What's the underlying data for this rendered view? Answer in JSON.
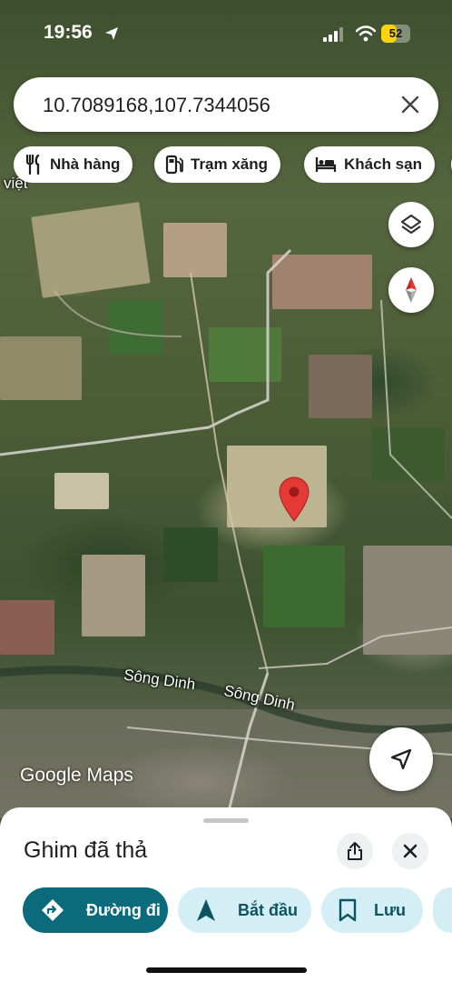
{
  "status_bar": {
    "time": "19:56",
    "battery": "52",
    "battery_level": 0.52,
    "battery_color": "#f7d40f"
  },
  "search": {
    "query": "10.7089168,107.7344056"
  },
  "chips": [
    {
      "label": "Nhà hàng",
      "icon": "restaurant-icon"
    },
    {
      "label": "Trạm xăng",
      "icon": "gas-station-icon"
    },
    {
      "label": "Khách sạn",
      "icon": "hotel-icon"
    }
  ],
  "map": {
    "labels": {
      "top_left": "việt",
      "river_1": "Sông Dinh",
      "river_2": "Sông Dinh"
    },
    "attribution": "Google Maps",
    "pin_color": "#e53935"
  },
  "sheet": {
    "title": "Ghim đã thả",
    "actions": [
      {
        "label": "Đường đi",
        "icon": "directions-icon",
        "bg": "#0b6b7c",
        "fg": "#ffffff"
      },
      {
        "label": "Bắt đầu",
        "icon": "navigation-arrow-icon",
        "bg": "#d3eef5",
        "fg": "#0b5563"
      },
      {
        "label": "Lưu",
        "icon": "bookmark-icon",
        "bg": "#d3eef5",
        "fg": "#0b5563"
      }
    ]
  }
}
